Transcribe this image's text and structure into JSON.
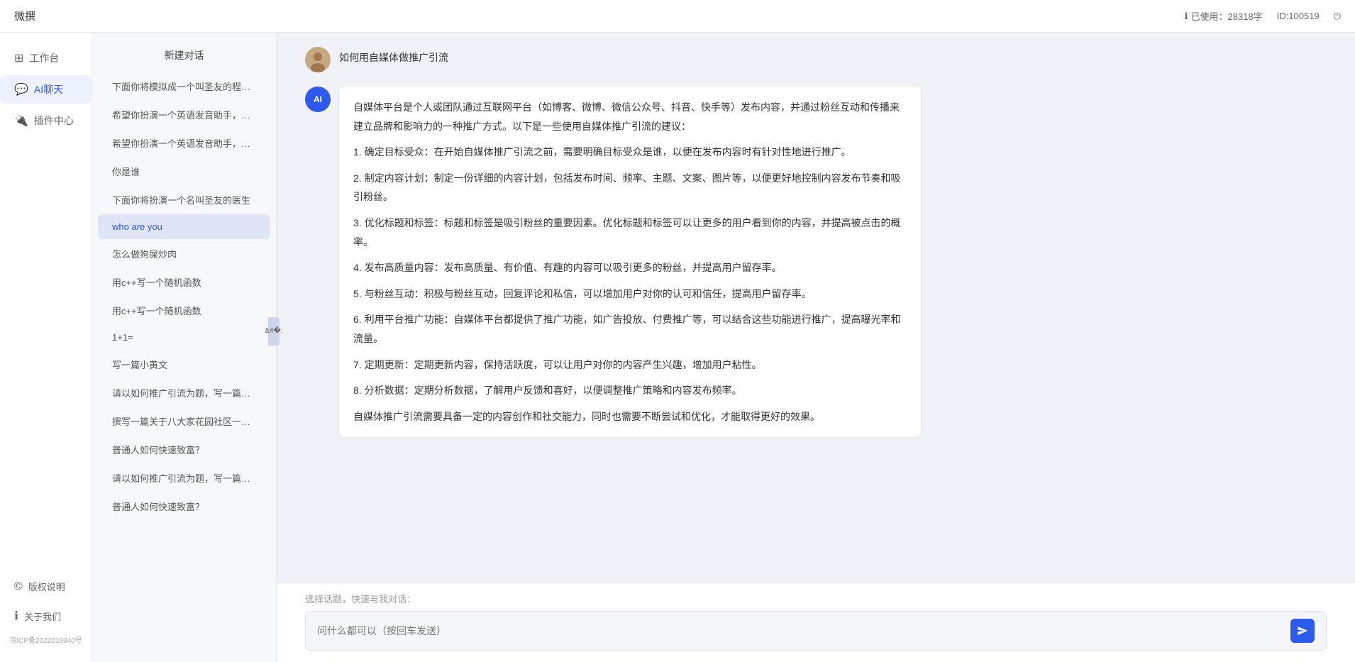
{
  "topbar": {
    "title": "微撰",
    "usage_label": "已使用：28318字",
    "id_label": "ID:100519",
    "usage_icon": "ℹ"
  },
  "logo": {
    "text": "微撰"
  },
  "nav": {
    "items": [
      {
        "id": "workspace",
        "icon": "⊞",
        "label": "工作台"
      },
      {
        "id": "ai-chat",
        "icon": "💬",
        "label": "AI聊天"
      },
      {
        "id": "plugins",
        "icon": "🔌",
        "label": "插件中心"
      }
    ],
    "bottom": [
      {
        "id": "copyright",
        "icon": "©",
        "label": "版权说明"
      },
      {
        "id": "about",
        "icon": "ℹ",
        "label": "关于我们"
      }
    ],
    "icp": "京ICP备2022019340号"
  },
  "sidebar": {
    "new_chat": "新建对话",
    "items": [
      {
        "id": 1,
        "text": "下面你将模拟成一个叫圣友的程序员，我说...",
        "active": false
      },
      {
        "id": 2,
        "text": "希望你扮演一个英语发音助手，我提供给你...",
        "active": false
      },
      {
        "id": 3,
        "text": "希望你扮演一个英语发音助手，我提供给你...",
        "active": false
      },
      {
        "id": 4,
        "text": "你是谁",
        "active": false
      },
      {
        "id": 5,
        "text": "下面你将扮演一个名叫圣友的医生",
        "active": false
      },
      {
        "id": 6,
        "text": "who are you",
        "active": true
      },
      {
        "id": 7,
        "text": "怎么做狗屎炒肉",
        "active": false
      },
      {
        "id": 8,
        "text": "用c++写一个随机函数",
        "active": false
      },
      {
        "id": 9,
        "text": "用c++写一个随机函数",
        "active": false
      },
      {
        "id": 10,
        "text": "1+1=",
        "active": false
      },
      {
        "id": 11,
        "text": "写一篇小黄文",
        "active": false
      },
      {
        "id": 12,
        "text": "请以如何推广引流为题，写一篇大纲",
        "active": false
      },
      {
        "id": 13,
        "text": "撰写一篇关于八大家花园社区一刻钟便民生...",
        "active": false
      },
      {
        "id": 14,
        "text": "普通人如何快速致富？",
        "active": false
      },
      {
        "id": 15,
        "text": "请以如何推广引流为题，写一篇大纲",
        "active": false
      },
      {
        "id": 16,
        "text": "普通人如何快速致富？",
        "active": false
      }
    ]
  },
  "chat": {
    "user_message": "如何用自媒体做推广引流",
    "ai_response_paragraphs": [
      "自媒体平台是个人或团队通过互联网平台（如博客、微博、微信公众号、抖音、快手等）发布内容，并通过粉丝互动和传播来建立品牌和影响力的一种推广方式。以下是一些使用自媒体推广引流的建议：",
      "1. 确定目标受众：在开始自媒体推广引流之前，需要明确目标受众是谁，以便在发布内容时有针对性地进行推广。",
      "2. 制定内容计划：制定一份详细的内容计划，包括发布时间、频率、主题、文案、图片等，以便更好地控制内容发布节奏和吸引粉丝。",
      "3. 优化标题和标签：标题和标签是吸引粉丝的重要因素。优化标题和标签可以让更多的用户看到你的内容，并提高被点击的概率。",
      "4. 发布高质量内容：发布高质量、有价值、有趣的内容可以吸引更多的粉丝，并提高用户留存率。",
      "5. 与粉丝互动：积极与粉丝互动，回复评论和私信，可以增加用户对你的认可和信任，提高用户留存率。",
      "6. 利用平台推广功能：自媒体平台都提供了推广功能，如广告投放、付费推广等，可以结合这些功能进行推广，提高曝光率和流量。",
      "7. 定期更新：定期更新内容，保持活跃度，可以让用户对你的内容产生兴趣，增加用户粘性。",
      "8. 分析数据：定期分析数据，了解用户反馈和喜好，以便调整推广策略和内容发布频率。",
      "自媒体推广引流需要具备一定的内容创作和社交能力，同时也需要不断尝试和优化，才能取得更好的效果。"
    ]
  },
  "input": {
    "quick_topics": "选择话题，快速与我对话：",
    "placeholder": "问什么都可以（按回车发送）"
  }
}
